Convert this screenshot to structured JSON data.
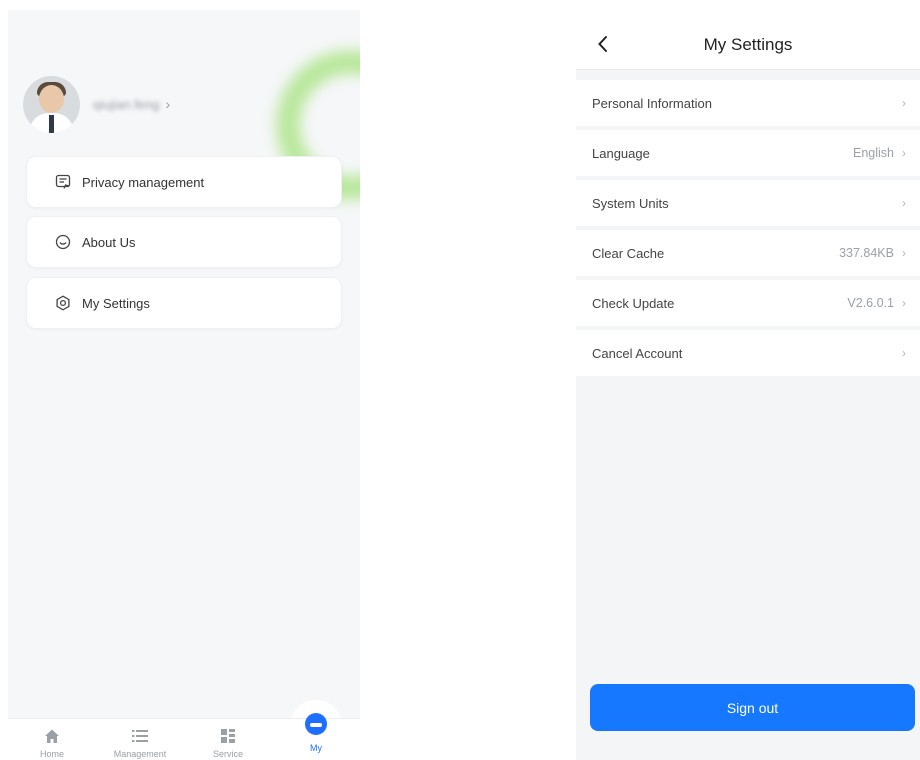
{
  "left": {
    "profile": {
      "username": "qiujian.feng",
      "chevron": "›"
    },
    "menu": [
      {
        "label": "Privacy management",
        "icon": "document-edit-icon"
      },
      {
        "label": "About Us",
        "icon": "smile-circle-icon"
      },
      {
        "label": "My Settings",
        "icon": "settings-gear-icon"
      }
    ],
    "tabs": [
      {
        "label": "Home",
        "icon": "home-icon"
      },
      {
        "label": "Management",
        "icon": "list-icon"
      },
      {
        "label": "Service",
        "icon": "grid-icon"
      },
      {
        "label": "My",
        "icon": "my-icon",
        "active": true
      }
    ]
  },
  "right": {
    "title": "My Settings",
    "back_icon": "‹",
    "items": [
      {
        "label": "Personal Information",
        "value": ""
      },
      {
        "label": "Language",
        "value": "English"
      },
      {
        "label": "System Units",
        "value": ""
      },
      {
        "label": "Clear Cache",
        "value": "337.84KB"
      },
      {
        "label": "Check Update",
        "value": "V2.6.0.1"
      },
      {
        "label": "Cancel Account",
        "value": ""
      }
    ],
    "chevron": "›",
    "signout_label": "Sign out"
  },
  "colors": {
    "accent": "#1677ff",
    "tab_active": "#1e6fff",
    "glow": "#aee58b"
  }
}
